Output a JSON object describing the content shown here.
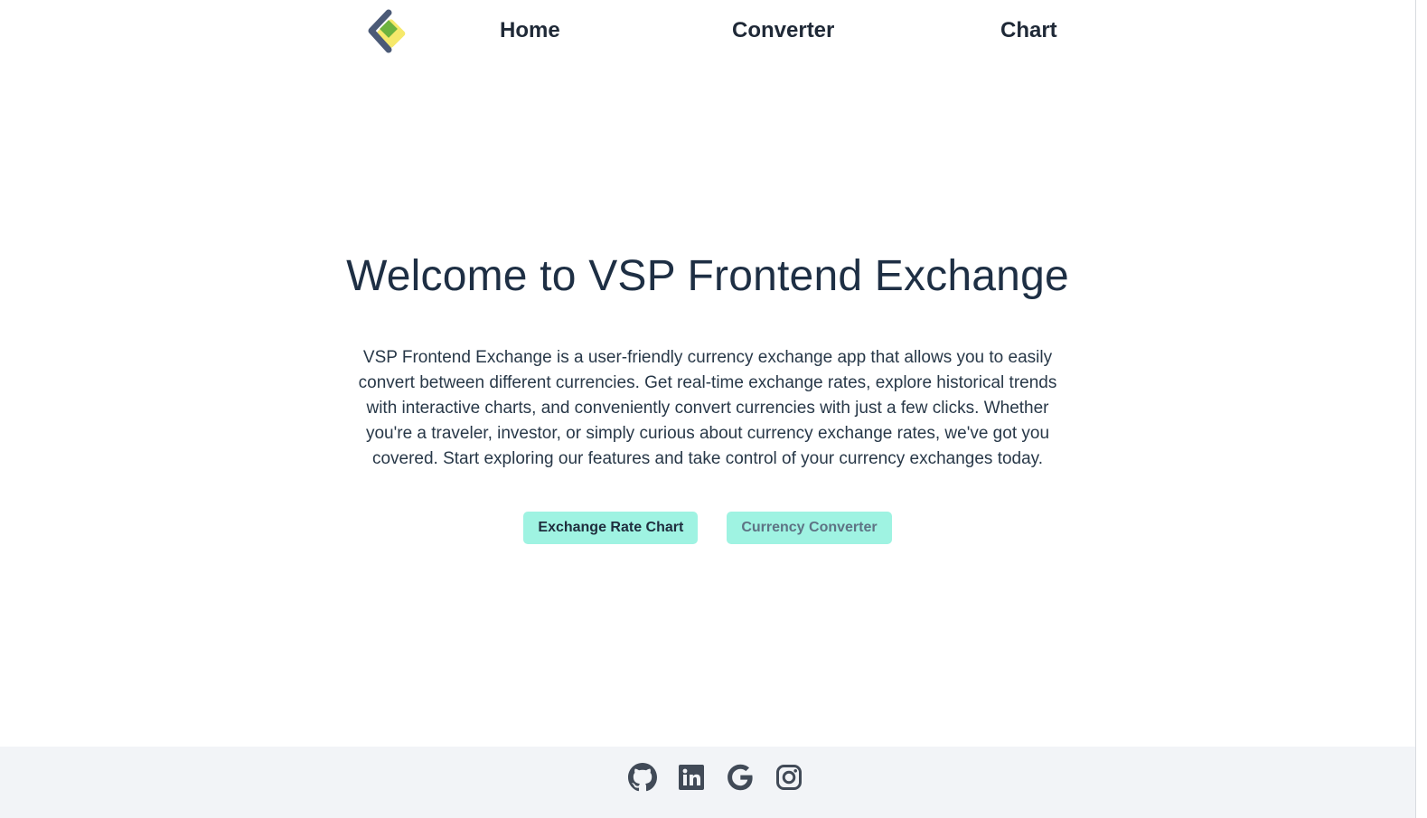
{
  "nav": {
    "logo_icon": "vsp-diamond-logo",
    "links": [
      {
        "label": "Home"
      },
      {
        "label": "Converter"
      },
      {
        "label": "Chart"
      }
    ]
  },
  "hero": {
    "title": "Welcome to VSP Frontend Exchange",
    "description": "VSP Frontend Exchange is a user-friendly currency exchange app that allows you to easily convert between different currencies. Get real-time exchange rates, explore historical trends with interactive charts, and conveniently convert currencies with just a few clicks. Whether you're a traveler, investor, or simply curious about currency exchange rates, we've got you covered. Start exploring our features and take control of your currency exchanges today.",
    "buttons": {
      "chart_label": "Exchange Rate Chart",
      "converter_label": "Currency Converter"
    }
  },
  "footer": {
    "social": [
      "github-icon",
      "linkedin-icon",
      "google-icon",
      "instagram-icon"
    ]
  },
  "colors": {
    "button_bg": "#9ff3e2",
    "heading": "#1e2f44",
    "footer_bg": "#f2f4f7",
    "icon": "#414a57",
    "logo_dark": "#4a5a78",
    "logo_green": "#6cb33f",
    "logo_yellow": "#f7ea6a"
  }
}
